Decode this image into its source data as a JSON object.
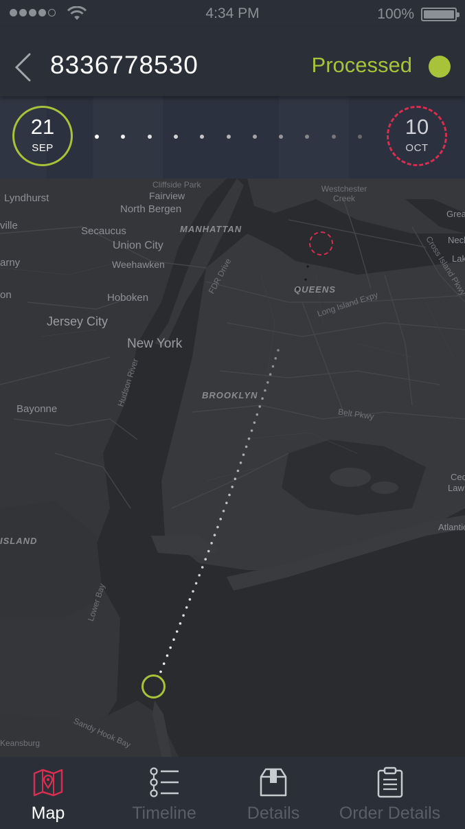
{
  "status_bar": {
    "time": "4:34 PM",
    "battery": "100%",
    "signal_bars": 5,
    "signal_bars_filled": 4
  },
  "header": {
    "title": "8336778530",
    "status": "Processed",
    "status_color": "#a8c33a",
    "back_icon": "chevron-left-icon"
  },
  "date_range": {
    "start": {
      "day": "21",
      "month": "SEP",
      "color": "#a8c33a"
    },
    "end": {
      "day": "10",
      "month": "OCT",
      "color": "#d92e52"
    },
    "dot_count": 11
  },
  "map": {
    "labels": {
      "lyndhurst": "Lyndhurst",
      "secaucus": "Secaucus",
      "north_bergen": "North Bergen",
      "fairview": "Fairview",
      "cliffside_park": "Cliffside Park",
      "union_city": "Union City",
      "weehawken": "Weehawken",
      "hoboken": "Hoboken",
      "jersey_city": "Jersey City",
      "new_york": "New York",
      "manhattan": "MANHATTAN",
      "queens": "QUEENS",
      "brooklyn": "BROOKLYN",
      "bayonne": "Bayonne",
      "staten_island": "ISLAND",
      "westchester_creek": "Westchester Creek",
      "fdr_drive": "FDR Drive",
      "long_island_expy": "Long Island Expy",
      "belt_pkwy": "Belt Pkwy",
      "cross_island_pkwy": "Cross Island Pkwy",
      "hudson_river": "Hudson River",
      "lower_bay": "Lower Bay",
      "sandy_hook_bay": "Sandy Hook Bay",
      "keansburg": "Keansburg",
      "great_neck": "Grea",
      "neck": "Neck",
      "lake": "Lak",
      "atlantic": "Atlantic",
      "cedar": "Ced",
      "lawrence": "Law",
      "ville": "ville",
      "arny": "arny",
      "on": "on"
    },
    "origin_marker_color": "#a8c33a",
    "destination_marker_color": "#d92e52"
  },
  "tabs": [
    {
      "label": "Map",
      "icon": "map-icon",
      "active": true
    },
    {
      "label": "Timeline",
      "icon": "timeline-list-icon",
      "active": false
    },
    {
      "label": "Details",
      "icon": "box-icon",
      "active": false
    },
    {
      "label": "Order Details",
      "icon": "clipboard-icon",
      "active": false
    }
  ]
}
